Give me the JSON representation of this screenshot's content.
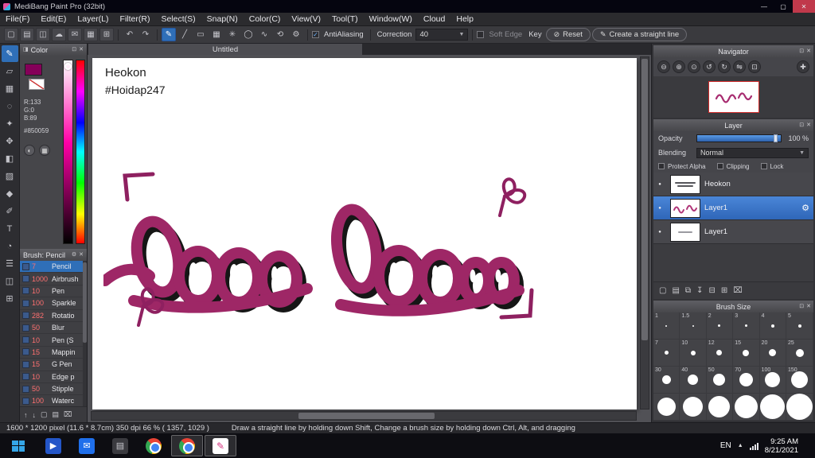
{
  "titlebar": {
    "title": "MediBang Paint Pro (32bit)"
  },
  "menubar": {
    "items": [
      "File(F)",
      "Edit(E)",
      "Layer(L)",
      "Filter(R)",
      "Select(S)",
      "Snap(N)",
      "Color(C)",
      "View(V)",
      "Tool(T)",
      "Window(W)",
      "Cloud",
      "Help"
    ]
  },
  "toolbar": {
    "antialiasing_label": "AntiAliasing",
    "correction_label": "Correction",
    "correction_value": "40",
    "soft_edge_label": "Soft Edge",
    "key_label": "Key",
    "reset_label": "Reset",
    "straight_line_label": "Create a straight line"
  },
  "color_panel": {
    "title": "Color",
    "r": "R:133",
    "g": "G:0",
    "b": "B:89",
    "hex": "#850059",
    "foreground_hex": "#850059"
  },
  "brush_panel": {
    "title": "Brush: Pencil",
    "brushes": [
      {
        "size": "7",
        "name": "Pencil"
      },
      {
        "size": "1000",
        "name": "Airbrush"
      },
      {
        "size": "10",
        "name": "Pen"
      },
      {
        "size": "100",
        "name": "Sparkle"
      },
      {
        "size": "282",
        "name": "Rotatio"
      },
      {
        "size": "50",
        "name": "Blur"
      },
      {
        "size": "10",
        "name": "Pen (S"
      },
      {
        "size": "15",
        "name": "Mappin"
      },
      {
        "size": "15",
        "name": "G Pen"
      },
      {
        "size": "10",
        "name": "Edge p"
      },
      {
        "size": "50",
        "name": "Stipple"
      },
      {
        "size": "100",
        "name": "Waterc"
      }
    ]
  },
  "canvas": {
    "tab": "Untitled",
    "line1": "Heokon",
    "line2": "#Hoidap247"
  },
  "navigator": {
    "title": "Navigator"
  },
  "layer_panel": {
    "title": "Layer",
    "opacity_label": "Opacity",
    "opacity_value": "100 %",
    "blending_label": "Blending",
    "blending_value": "Normal",
    "protect_alpha_label": "Protect Alpha",
    "clipping_label": "Clipping",
    "lock_label": "Lock",
    "layers": [
      {
        "name": "Heokon"
      },
      {
        "name": "Layer1"
      },
      {
        "name": "Layer1"
      }
    ]
  },
  "brush_size_panel": {
    "title": "Brush Size",
    "sizes": [
      "1",
      "1.5",
      "2",
      "3",
      "4",
      "5",
      "7",
      "10",
      "12",
      "15",
      "20",
      "25",
      "30",
      "40",
      "50",
      "70",
      "100",
      "150"
    ]
  },
  "status_bar": {
    "info": "1600 * 1200 pixel   (11.6 * 8.7cm)   350 dpi   66 %   ( 1357, 1029 )",
    "hint": "Draw a straight line by holding down Shift, Change a brush size by holding down Ctrl, Alt, and dragging"
  },
  "taskbar": {
    "language": "EN",
    "time": "9:25 AM",
    "date": "8/21/2021"
  },
  "colors": {
    "accent_magenta": "#850059",
    "drawing_magenta": "#9e2766",
    "selection_blue": "#3c78c8"
  }
}
